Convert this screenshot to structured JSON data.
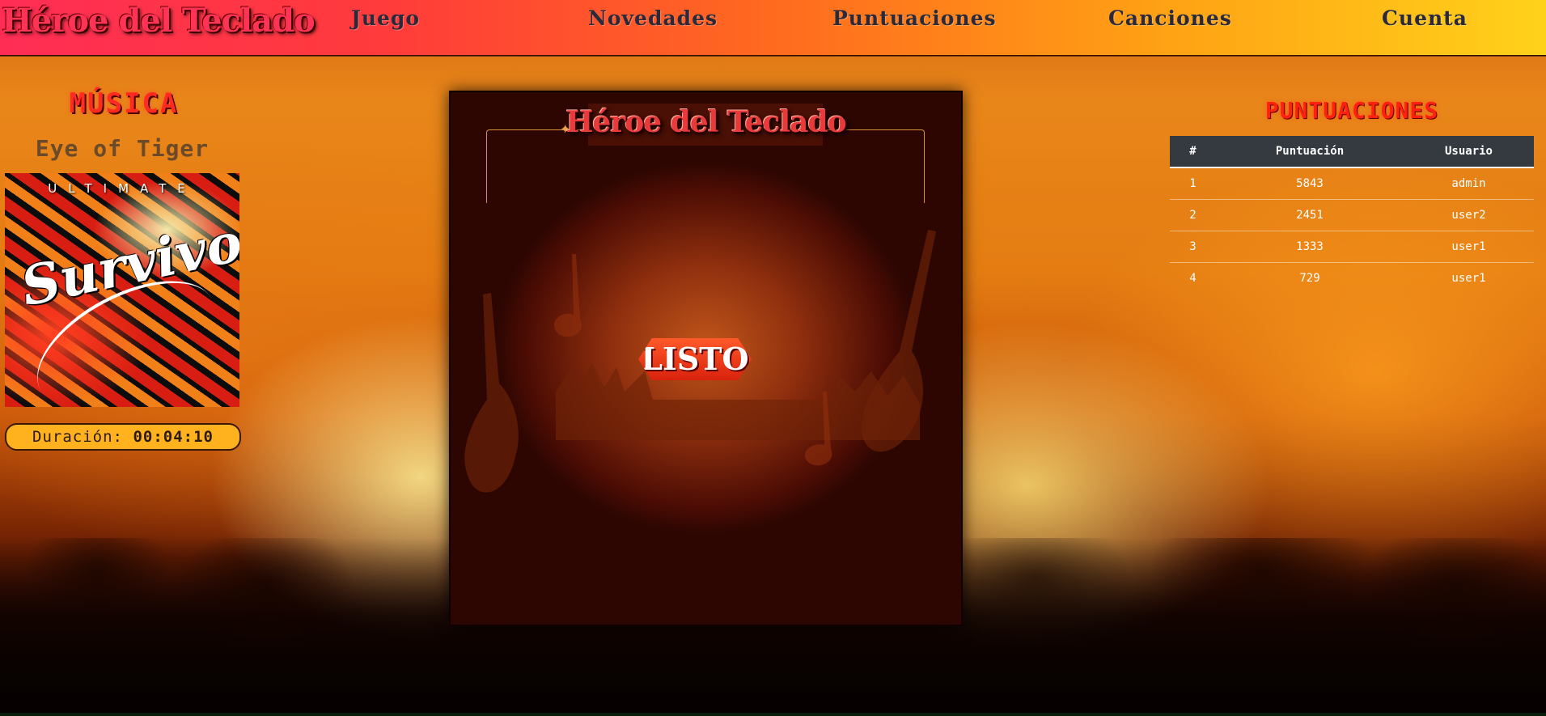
{
  "nav": {
    "brand": "Héroe del Teclado",
    "items": [
      {
        "label": "Juego"
      },
      {
        "label": "Novedades"
      },
      {
        "label": "Puntuaciones"
      },
      {
        "label": "Canciones"
      },
      {
        "label": "Cuenta"
      }
    ]
  },
  "music": {
    "title": "MÚSICA",
    "song": "Eye of Tiger",
    "album_top_text": "ULTIMATE",
    "album_script_text": "Survivor",
    "duration_label": "Duración:",
    "duration_value": "00:04:10"
  },
  "game": {
    "logo": "Héroe del Teclado",
    "ready_label": "LISTO"
  },
  "scores": {
    "title": "PUNTUACIONES",
    "headers": [
      "#",
      "Puntuación",
      "Usuario"
    ],
    "rows": [
      {
        "rank": "1",
        "score": "5843",
        "user": "admin"
      },
      {
        "rank": "2",
        "score": "2451",
        "user": "user2"
      },
      {
        "rank": "3",
        "score": "1333",
        "user": "user1"
      },
      {
        "rank": "4",
        "score": "729",
        "user": "user1"
      }
    ]
  },
  "colors": {
    "nav_gradient_start": "#ff2d55",
    "nav_gradient_end": "#ffd21a",
    "accent_red": "#ff2a20",
    "duration_bg": "#ffb21e",
    "table_header_bg": "#343a40"
  }
}
